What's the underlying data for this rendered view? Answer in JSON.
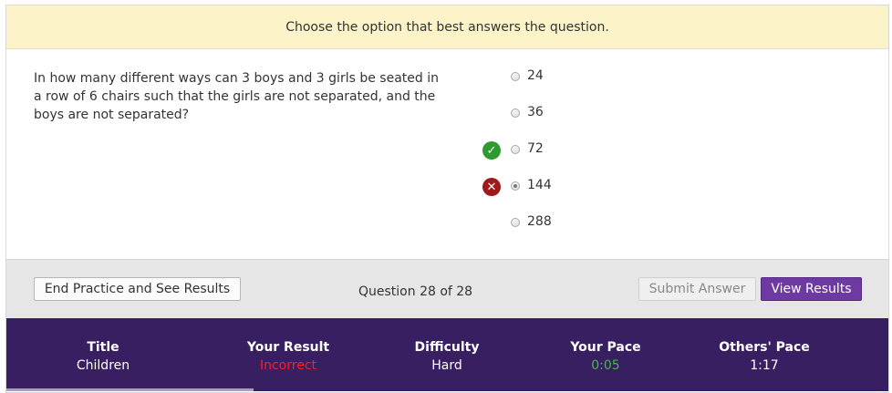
{
  "banner": {
    "text": "Choose the option that best answers the question."
  },
  "question": {
    "text": "In how many different ways can 3 boys and 3 girls be seated in a row of 6 chairs such that the girls are not separated, and the boys are not separated?"
  },
  "options": [
    {
      "label": "24",
      "selected": false,
      "status": ""
    },
    {
      "label": "36",
      "selected": false,
      "status": ""
    },
    {
      "label": "72",
      "selected": false,
      "status": "correct"
    },
    {
      "label": "144",
      "selected": true,
      "status": "incorrect"
    },
    {
      "label": "288",
      "selected": false,
      "status": ""
    }
  ],
  "toolbar": {
    "end_label": "End Practice and See Results",
    "question_count": "Question 28 of 28",
    "submit_label": "Submit Answer",
    "view_label": "View Results"
  },
  "stats": {
    "title": {
      "label": "Title",
      "value": "Children"
    },
    "result": {
      "label": "Your Result",
      "value": "Incorrect"
    },
    "difficulty": {
      "label": "Difficulty",
      "value": "Hard"
    },
    "your_pace": {
      "label": "Your Pace",
      "value": "0:05"
    },
    "others_pace": {
      "label": "Others' Pace",
      "value": "1:17"
    }
  },
  "icons": {
    "correct": "check-icon",
    "incorrect": "x-icon"
  },
  "colors": {
    "accent": "#6c3aa0",
    "stats_bg": "#371f62",
    "banner_bg": "#fcf3c9",
    "correct": "#2f9b2f",
    "incorrect": "#9e1a1a",
    "result_bad": "#ff1f1f",
    "pace_good": "#3fbf3f"
  }
}
